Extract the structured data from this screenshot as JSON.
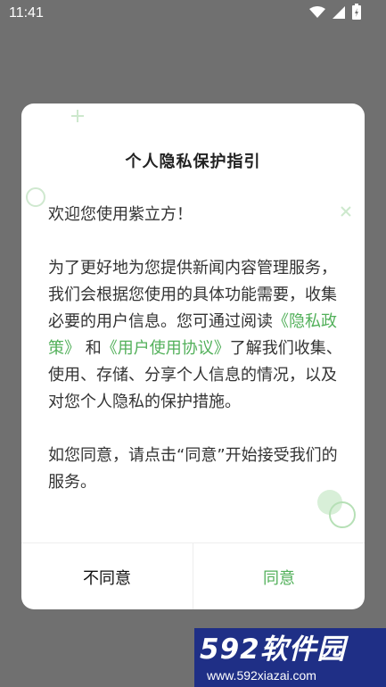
{
  "status_bar": {
    "time": "11:41",
    "icons": [
      "wifi-icon",
      "cell-signal-icon",
      "battery-icon"
    ]
  },
  "dialog": {
    "title": "个人隐私保护指引",
    "para1": "欢迎您使用紫立方！",
    "para2_a": "为了更好地为您提供新闻内容管理服务，我们会根据您使用的具体功能需要，收集必要的用户信息。您可通过阅读",
    "privacy_link": "《隐私政策》",
    "para2_and": "和",
    "agreement_link": "《用户使用协议》",
    "para2_b": "了解我们收集、使用、存储、分享个人信息的情况，以及对您个人隐私的保护措施。",
    "para3": "如您同意，请点击“同意”开始接受我们的服务。",
    "disagree_label": "不同意",
    "agree_label": "同意"
  },
  "watermark": {
    "logo": "592软件园",
    "url": "www.592xiazai.com"
  },
  "colors": {
    "overlay": "#707070",
    "accent": "#52b05a",
    "watermark_bg": "#1f2f86"
  }
}
